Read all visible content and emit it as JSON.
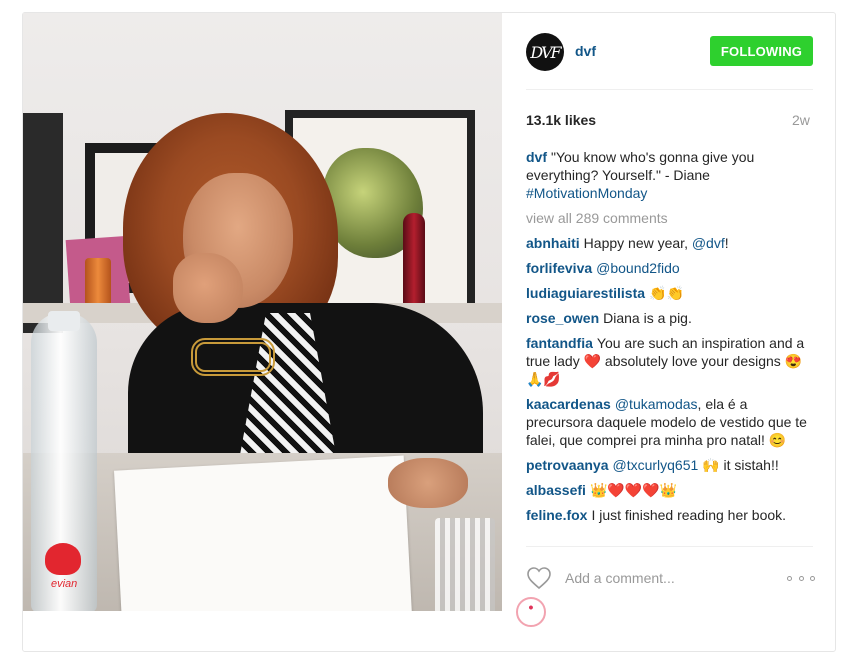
{
  "post": {
    "username": "dvf",
    "avatar_text": "DVF",
    "follow_label": "FOLLOWING",
    "follow_color": "#2ed02e",
    "likes": "13.1k likes",
    "age": "2w"
  },
  "photo": {
    "bottle_brand": "evian"
  },
  "caption": {
    "user": "dvf",
    "text": "\"You know who's gonna give you everything? Yourself.\" - Diane",
    "hashtag": "#MotivationMonday"
  },
  "view_all": "view all 289 comments",
  "comments": [
    {
      "user": "abnhaiti",
      "text": "Happy new year, ",
      "mention": "@dvf",
      "suffix": "!"
    },
    {
      "user": "forlifeviva",
      "text": "",
      "mention": "@bound2fido",
      "suffix": ""
    },
    {
      "user": "ludiaguiarestilista",
      "text": "👏👏",
      "mention": "",
      "suffix": ""
    },
    {
      "user": "rose_owen",
      "text": "Diana is a pig.",
      "mention": "",
      "suffix": ""
    },
    {
      "user": "fantandfia",
      "text": "You are such an inspiration and a true lady ❤️ absolutely love your designs 😍🙏💋",
      "mention": "",
      "suffix": ""
    },
    {
      "user": "kaacardenas",
      "text": "",
      "mention": "@tukamodas",
      "suffix": ", ela é a precursora daquele modelo de vestido que te falei, que comprei pra minha pro natal! 😊"
    },
    {
      "user": "petrovaanya",
      "text": "",
      "mention": "@txcurlyq651",
      "suffix": " 🙌 it sistah!!"
    },
    {
      "user": "albassefi",
      "text": "👑❤️❤️❤️👑",
      "mention": "",
      "suffix": ""
    },
    {
      "user": "feline.fox",
      "text": "I just finished reading her book.",
      "mention": "",
      "suffix": ""
    }
  ],
  "add_comment": {
    "placeholder": "Add a comment..."
  },
  "colors": {
    "link": "#125688",
    "muted": "#999999"
  }
}
